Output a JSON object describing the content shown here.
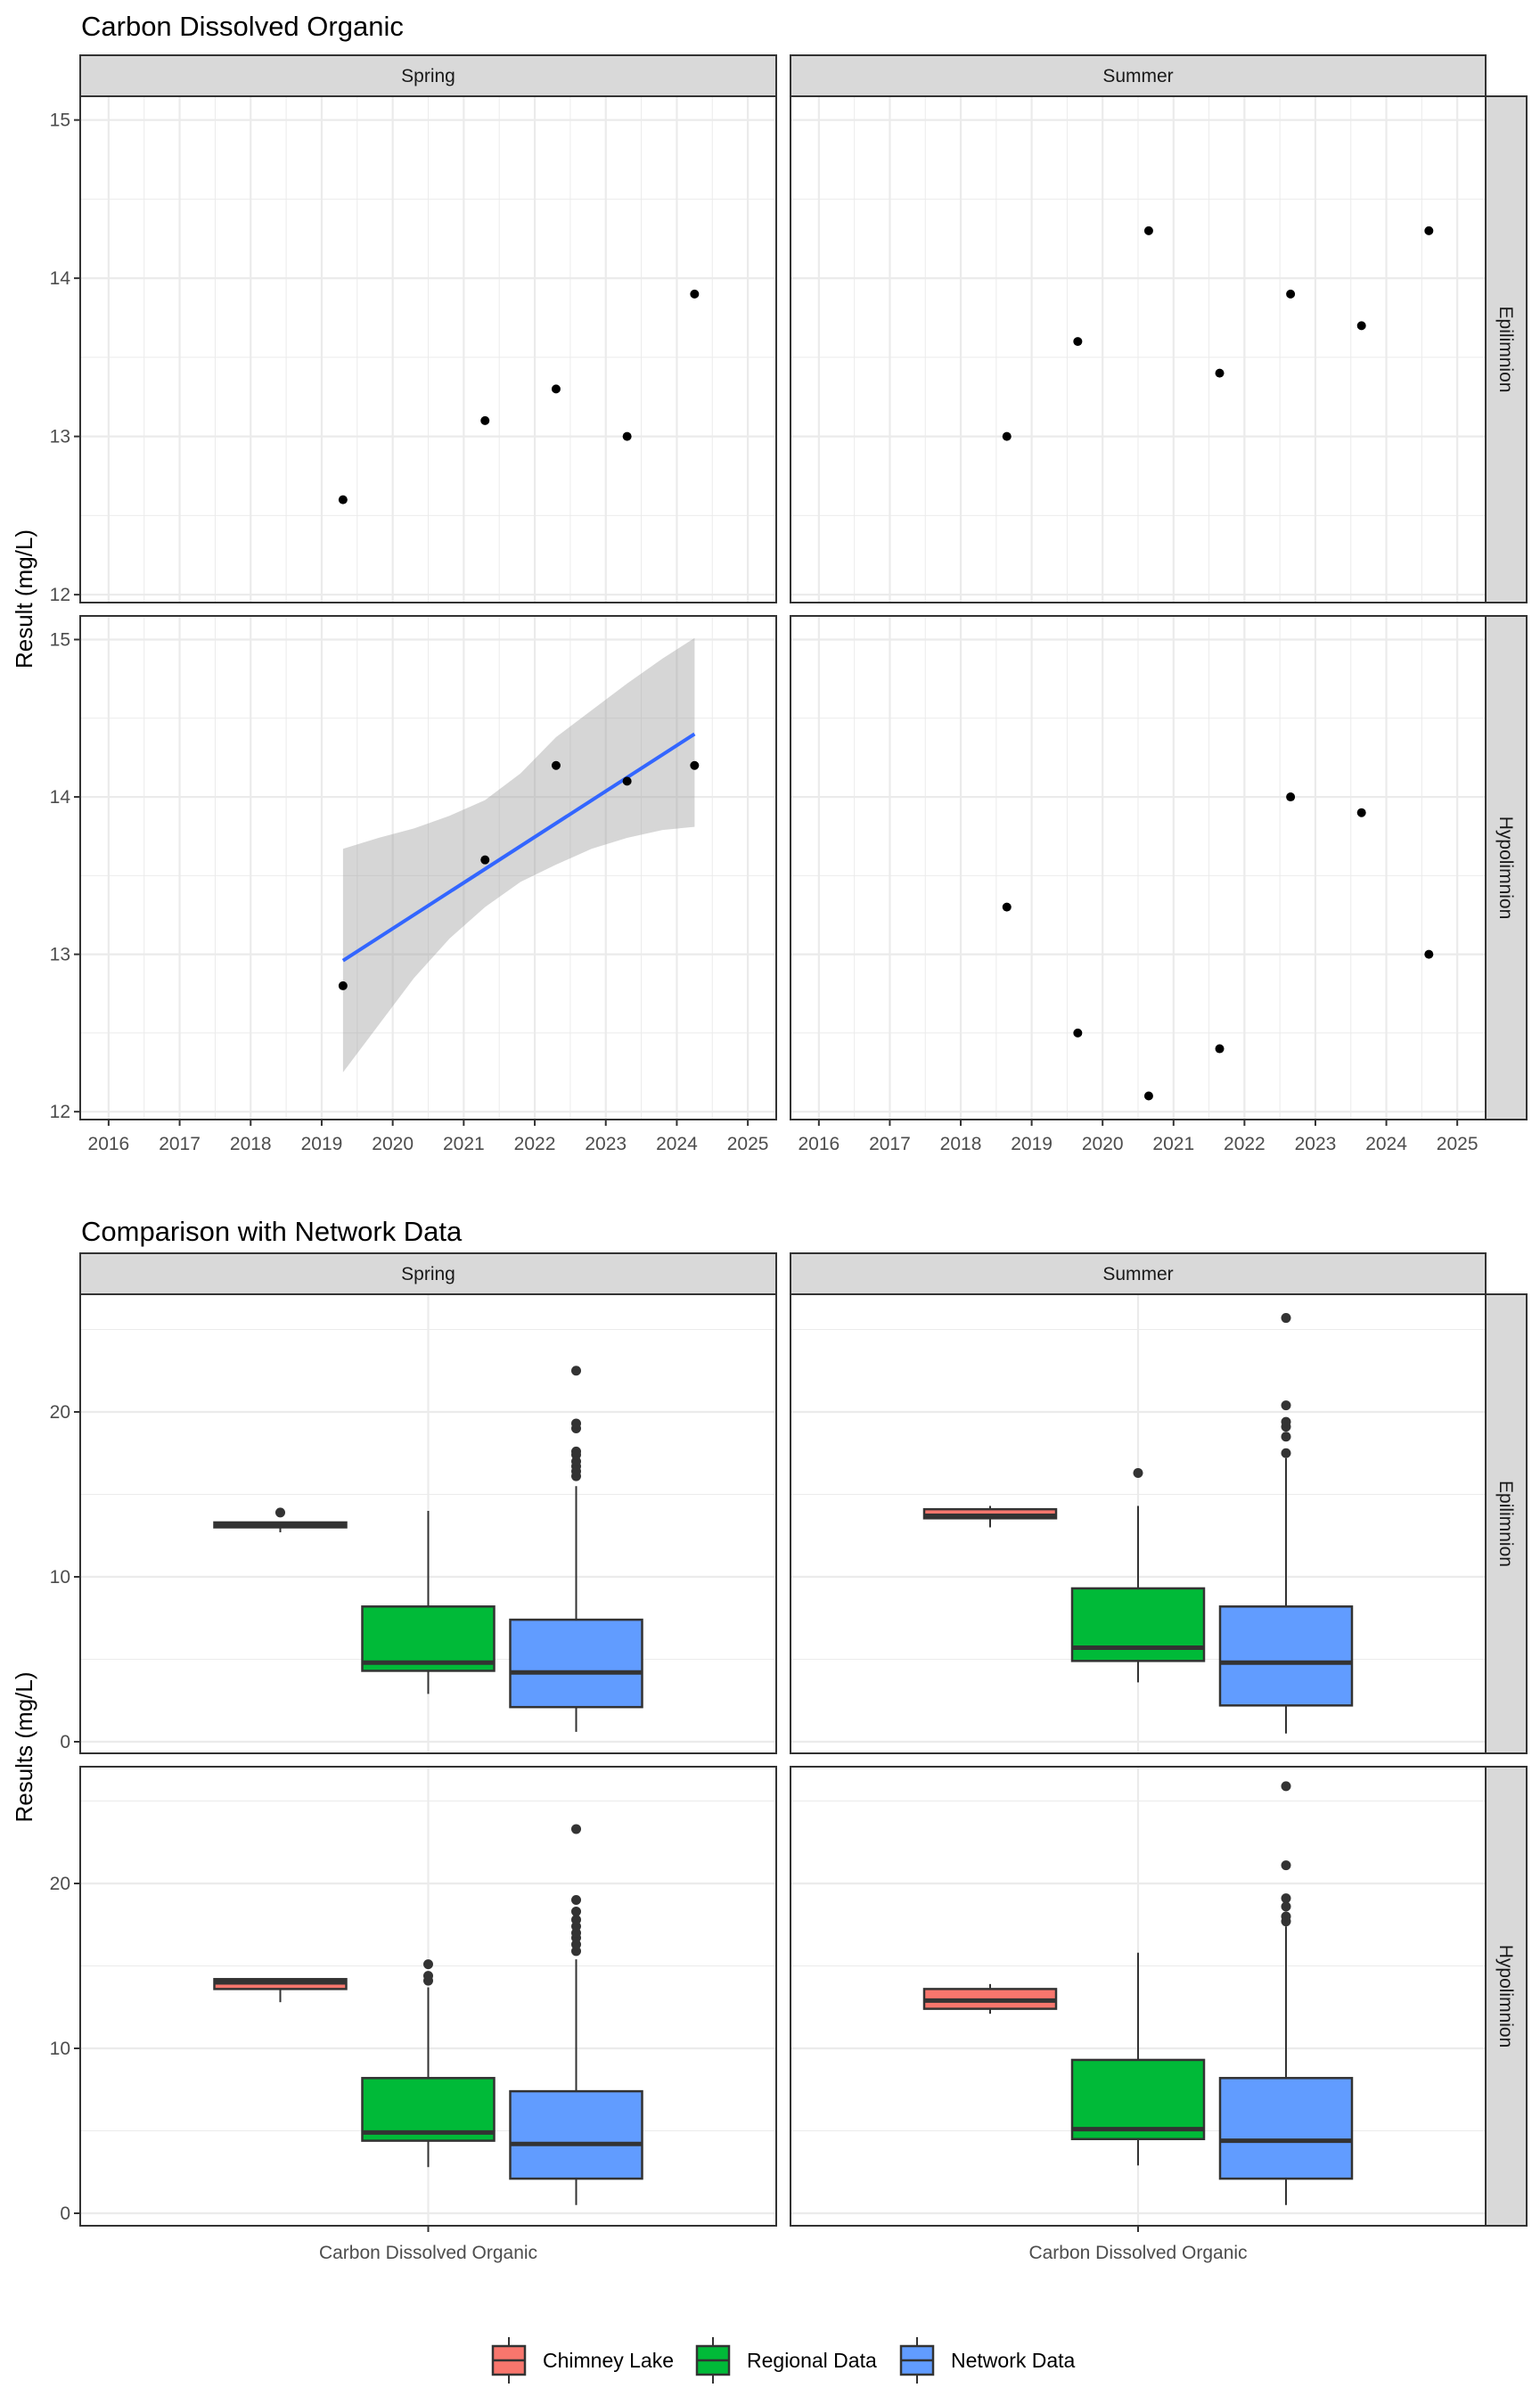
{
  "chart_data": [
    {
      "type": "scatter",
      "title": "Carbon Dissolved Organic",
      "xlabel": "",
      "ylabel": "Result (mg/L)",
      "xlim": [
        2015.6,
        2025.4
      ],
      "ylim": [
        11.95,
        15.15
      ],
      "x_ticks": [
        "2016",
        "2017",
        "2018",
        "2019",
        "2020",
        "2021",
        "2022",
        "2023",
        "2024",
        "2025"
      ],
      "y_ticks": [
        "12",
        "13",
        "14",
        "15"
      ],
      "grid": true,
      "columns": [
        "Spring",
        "Summer"
      ],
      "rows": [
        "Epilimnion",
        "Hypolimnion"
      ],
      "panels": [
        {
          "column": "Spring",
          "row": "Epilimnion",
          "points": [
            {
              "x": 2019.3,
              "y": 12.6
            },
            {
              "x": 2021.3,
              "y": 13.1
            },
            {
              "x": 2022.3,
              "y": 13.3
            },
            {
              "x": 2023.3,
              "y": 13.0
            },
            {
              "x": 2024.25,
              "y": 13.9
            }
          ]
        },
        {
          "column": "Summer",
          "row": "Epilimnion",
          "points": [
            {
              "x": 2018.65,
              "y": 13.0
            },
            {
              "x": 2019.65,
              "y": 13.6
            },
            {
              "x": 2020.65,
              "y": 14.3
            },
            {
              "x": 2021.65,
              "y": 13.4
            },
            {
              "x": 2022.65,
              "y": 13.9
            },
            {
              "x": 2023.65,
              "y": 13.7
            },
            {
              "x": 2024.6,
              "y": 14.3
            }
          ]
        },
        {
          "column": "Spring",
          "row": "Hypolimnion",
          "points": [
            {
              "x": 2019.3,
              "y": 12.8
            },
            {
              "x": 2021.3,
              "y": 13.6
            },
            {
              "x": 2022.3,
              "y": 14.2
            },
            {
              "x": 2023.3,
              "y": 14.1
            },
            {
              "x": 2024.25,
              "y": 14.2
            }
          ],
          "trend": {
            "method": "linear",
            "color": "#3366FF",
            "x": [
              2019.3,
              2024.25
            ],
            "y": [
              12.96,
              14.4
            ],
            "ci_x": [
              2019.3,
              2019.8,
              2020.3,
              2020.8,
              2021.3,
              2021.8,
              2022.3,
              2022.8,
              2023.3,
              2023.8,
              2024.25
            ],
            "ci_upper": [
              13.67,
              13.74,
              13.8,
              13.88,
              13.98,
              14.15,
              14.38,
              14.55,
              14.72,
              14.88,
              15.01
            ],
            "ci_lower": [
              12.25,
              12.55,
              12.85,
              13.1,
              13.3,
              13.46,
              13.57,
              13.67,
              13.74,
              13.79,
              13.81
            ]
          }
        },
        {
          "column": "Summer",
          "row": "Hypolimnion",
          "points": [
            {
              "x": 2018.65,
              "y": 13.3
            },
            {
              "x": 2019.65,
              "y": 12.5
            },
            {
              "x": 2020.65,
              "y": 12.1
            },
            {
              "x": 2021.65,
              "y": 12.4
            },
            {
              "x": 2022.65,
              "y": 14.0
            },
            {
              "x": 2023.65,
              "y": 13.9
            },
            {
              "x": 2024.6,
              "y": 13.0
            }
          ]
        }
      ]
    },
    {
      "type": "boxplot",
      "title": "Comparison with Network Data",
      "xlabel": "",
      "ylabel": "Results (mg/L)",
      "ylim": [
        -1.2,
        27.1
      ],
      "y_ticks": [
        "0",
        "10",
        "20"
      ],
      "x_category": "Carbon Dissolved Organic",
      "grid": true,
      "columns": [
        "Spring",
        "Summer"
      ],
      "rows": [
        "Epilimnion",
        "Hypolimnion"
      ],
      "legend": {
        "position": "bottom",
        "entries": [
          {
            "label": "Chimney Lake",
            "color": "#F8766D"
          },
          {
            "label": "Regional Data",
            "color": "#00BA38"
          },
          {
            "label": "Network Data",
            "color": "#619CFF"
          }
        ]
      },
      "panels": [
        {
          "column": "Spring",
          "row": "Epilimnion",
          "boxes": [
            {
              "group": "Chimney Lake",
              "lower_whisker": 12.7,
              "q1": 13.0,
              "median": 13.15,
              "q3": 13.3,
              "upper_whisker": 13.3,
              "outliers": [
                13.9
              ]
            },
            {
              "group": "Regional Data",
              "lower_whisker": 2.9,
              "q1": 4.3,
              "median": 4.8,
              "q3": 8.2,
              "upper_whisker": 14.0,
              "outliers": []
            },
            {
              "group": "Network Data",
              "lower_whisker": 0.6,
              "q1": 2.1,
              "median": 4.2,
              "q3": 7.4,
              "upper_whisker": 15.5,
              "outliers": [
                16.1,
                16.4,
                16.7,
                17.0,
                17.4,
                17.6,
                19.0,
                19.3,
                22.5
              ]
            }
          ]
        },
        {
          "column": "Summer",
          "row": "Epilimnion",
          "boxes": [
            {
              "group": "Chimney Lake",
              "lower_whisker": 13.0,
              "q1": 13.55,
              "median": 13.7,
              "q3": 14.1,
              "upper_whisker": 14.3,
              "outliers": []
            },
            {
              "group": "Regional Data",
              "lower_whisker": 3.6,
              "q1": 4.9,
              "median": 5.7,
              "q3": 9.3,
              "upper_whisker": 14.3,
              "outliers": [
                16.3
              ]
            },
            {
              "group": "Network Data",
              "lower_whisker": 0.5,
              "q1": 2.2,
              "median": 4.8,
              "q3": 8.2,
              "upper_whisker": 17.2,
              "outliers": [
                17.5,
                18.5,
                19.1,
                19.4,
                20.4,
                25.7
              ]
            }
          ]
        },
        {
          "column": "Spring",
          "row": "Hypolimnion",
          "boxes": [
            {
              "group": "Chimney Lake",
              "lower_whisker": 12.8,
              "q1": 13.6,
              "median": 14.0,
              "q3": 14.2,
              "upper_whisker": 14.2,
              "outliers": []
            },
            {
              "group": "Regional Data",
              "lower_whisker": 2.8,
              "q1": 4.4,
              "median": 4.9,
              "q3": 8.2,
              "upper_whisker": 13.7,
              "outliers": [
                14.1,
                14.4,
                15.1
              ]
            },
            {
              "group": "Network Data",
              "lower_whisker": 0.5,
              "q1": 2.1,
              "median": 4.2,
              "q3": 7.4,
              "upper_whisker": 15.4,
              "outliers": [
                15.9,
                16.3,
                16.7,
                17.0,
                17.4,
                17.8,
                18.3,
                19.0,
                23.3
              ]
            }
          ]
        },
        {
          "column": "Summer",
          "row": "Hypolimnion",
          "boxes": [
            {
              "group": "Chimney Lake",
              "lower_whisker": 12.1,
              "q1": 12.4,
              "median": 12.9,
              "q3": 13.6,
              "upper_whisker": 13.9,
              "outliers": []
            },
            {
              "group": "Regional Data",
              "lower_whisker": 2.9,
              "q1": 4.5,
              "median": 5.1,
              "q3": 9.3,
              "upper_whisker": 15.8,
              "outliers": []
            },
            {
              "group": "Network Data",
              "lower_whisker": 0.5,
              "q1": 2.1,
              "median": 4.4,
              "q3": 8.2,
              "upper_whisker": 17.4,
              "outliers": [
                17.7,
                18.0,
                18.6,
                19.1,
                21.1,
                25.9
              ]
            }
          ]
        }
      ]
    }
  ]
}
